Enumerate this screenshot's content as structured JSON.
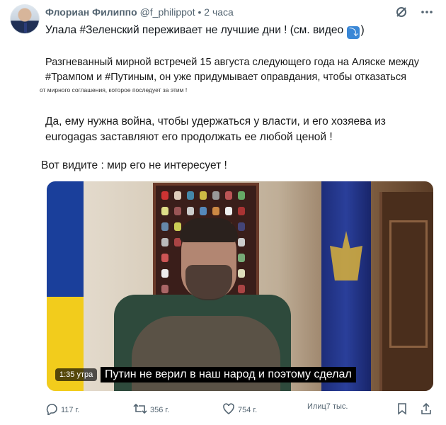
{
  "post": {
    "author_name": "Флориан Филиппо",
    "author_handle": "@f_philippot",
    "separator": "•",
    "time": "2 часа",
    "line1_before": "Улала #Зеленский переживает не лучшие дни ! (см. видео",
    "line1_after": ")",
    "down_emoji": "⤵",
    "p1": "Разгневанный мирной встречей 15 августа следующего года на Аляске между #Трампом и #Путиным, он уже придумывает оправдания, чтобы отказаться",
    "p1_small": "от мирного соглашения, которое последует за этим !",
    "p2": "Да, ему нужна война, чтобы удержаться у власти, и его хозяева из eurogagas заставляют его продолжать ее любой ценой !",
    "p3": "Вот видите : мир его не интересует !"
  },
  "video": {
    "timestamp": "1:35 утра",
    "subtitle": "Путин не верил в наш народ и поэтому сделал"
  },
  "actions": {
    "reply_count": "117 г.",
    "repost_count": "356 г.",
    "like_count": "754 г.",
    "views_label": "Илиц7 тыс."
  },
  "icons": {
    "grok": "slash-circle-icon",
    "more": "more-icon",
    "reply": "reply-icon",
    "repost": "repost-icon",
    "like": "heart-icon",
    "bookmark": "bookmark-icon",
    "share": "share-icon"
  },
  "colors": {
    "muted": "#536471",
    "text": "#0f1419",
    "emoji_blue": "#3a87d6"
  }
}
